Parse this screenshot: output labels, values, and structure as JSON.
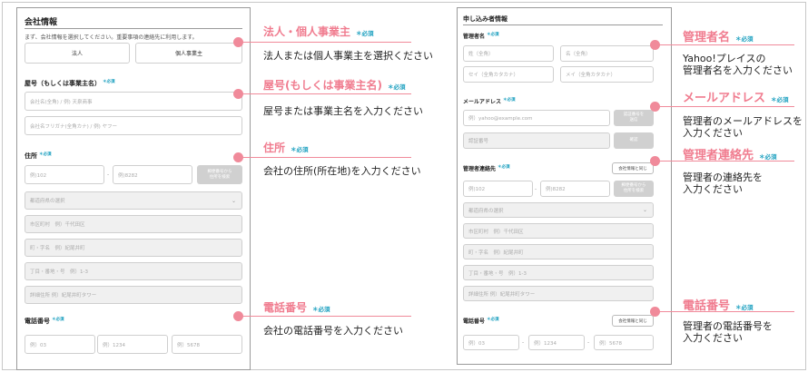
{
  "left": {
    "title": "会社情報",
    "intro": "まず、会社情報を選択してください。重要事項の連絡先に利用します。",
    "toggle": [
      "法人",
      "個人事業主"
    ],
    "shop": {
      "label": "屋号（もしくは事業主名）",
      "req": "＊必須",
      "name_ph": "会社名(全角) / 例) 天泉商事",
      "kana_ph": "会社名フリガナ(全角カナ) / 例) ヤフー"
    },
    "address": {
      "label": "住所",
      "req": "＊必須",
      "zip1": "例)102",
      "dash": "-",
      "zip2": "例)8282",
      "btn": "郵便番号から\n住所を検索",
      "pref": "都道府県の選択",
      "city": "市区町村　例）千代田区",
      "town": "町・字名　例）紀尾井町",
      "block": "丁目・番地・号　例）1-3",
      "bldg": "詳細住所 例）紀尾井町タワー"
    },
    "phone": {
      "label": "電話番号",
      "req": "＊必須",
      "p1": "例）03",
      "p2": "例）1234",
      "p3": "例）5678"
    }
  },
  "right": {
    "title": "申し込み者情報",
    "manager": {
      "label": "管理者名",
      "req": "＊必須",
      "sei": "姓（全角）",
      "mei": "名（全角）",
      "sei_kana": "セイ（全角カタカナ）",
      "mei_kana": "メイ（全角カタカナ）"
    },
    "mail": {
      "label": "メールアドレス",
      "req": "＊必須",
      "ph": "例）yahoo@example.com",
      "btn": "認証番号を\n送信",
      "code": "認証番号",
      "confirm": "確認"
    },
    "contact": {
      "label": "管理者連絡先",
      "req": "＊必須",
      "same_btn": "会社情報と同じ",
      "zip1": "例)102",
      "dash": "-",
      "zip2": "例)8282",
      "btn": "郵便番号から\n住所を検索",
      "pref": "都道府県の選択",
      "city": "市区町村　例）千代田区",
      "town": "町・字名　例）紀尾井町",
      "block": "丁目・番地・号　例）1-3",
      "bldg": "詳細住所 例）紀尾井町タワー"
    },
    "phone": {
      "label": "電話番号",
      "req": "＊必須",
      "same_btn": "会社情報と同じ",
      "p1": "例）03",
      "p2": "例）1234",
      "p3": "例）5678",
      "dash": "-"
    }
  },
  "annotations": {
    "corp": {
      "title": "法人・個人事業主",
      "req": "＊必須",
      "desc": "法人または個人事業主を選択ください"
    },
    "shop": {
      "title": "屋号(もしくは事業主名)",
      "req": "＊必須",
      "desc": "屋号または事業主名を入力ください"
    },
    "addr": {
      "title": "住所",
      "req": "＊必須",
      "desc": "会社の住所(所在地)を入力ください"
    },
    "tel": {
      "title": "電話番号",
      "req": "＊必須",
      "desc": "会社の電話番号を入力ください"
    },
    "mgr": {
      "title": "管理者名",
      "req": "＊必須",
      "desc1": "Yahoo!プレイスの",
      "desc2": "管理者名を入力ください"
    },
    "mail": {
      "title": "メールアドレス",
      "req": "＊必須",
      "desc1": "管理者のメールアドレスを",
      "desc2": "入力ください"
    },
    "contact": {
      "title": "管理者連絡先",
      "req": "＊必須",
      "desc1": "管理者の連絡先を",
      "desc2": "入力ください"
    },
    "tel2": {
      "title": "電話番号",
      "req": "＊必須",
      "desc1": "管理者の電話番号を",
      "desc2": "入力ください"
    }
  },
  "colors": {
    "annotation": "#f07c8f",
    "dot": "#f08a9a",
    "required": "#1a9fbf"
  }
}
